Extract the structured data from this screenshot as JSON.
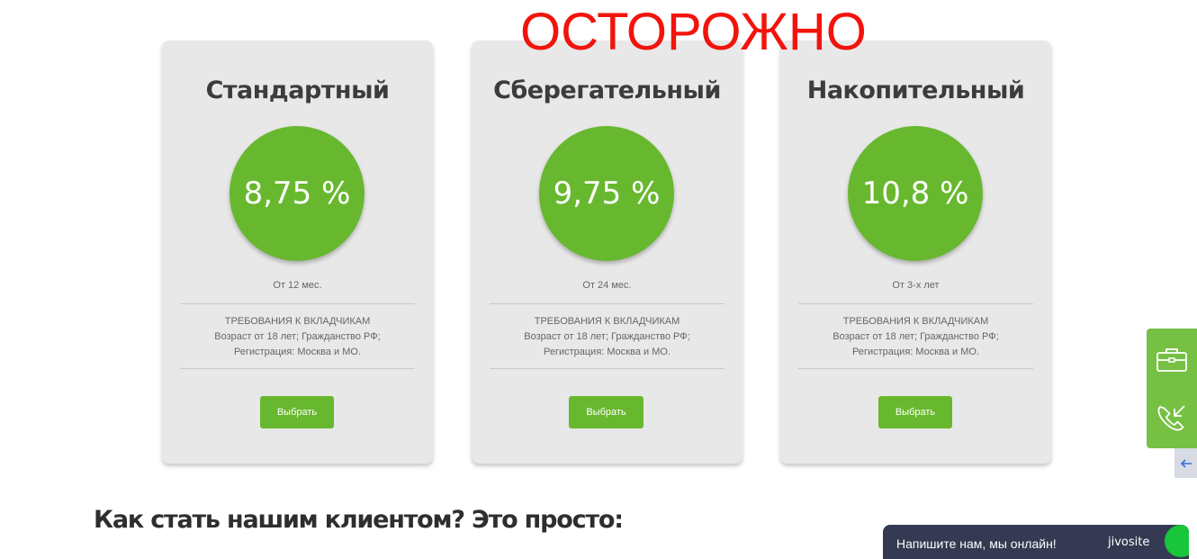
{
  "warning": "ОСТОРОЖНО",
  "colors": {
    "accent_green": "#68b82f",
    "warning_red": "#f2140c",
    "card_bg": "#e8e8e8",
    "chat_bg": "#353a52"
  },
  "plans": [
    {
      "title": "Стандартный",
      "rate": "8,75 %",
      "term": "От 12 мес.",
      "requirements_title": "ТРЕБОВАНИЯ К ВКЛАДЧИКАМ",
      "requirements_line1": "Возраст от 18 лет; Гражданство РФ;",
      "requirements_line2": "Регистрация: Москва и МО.",
      "button": "Выбрать"
    },
    {
      "title": "Сберегательный",
      "rate": "9,75 %",
      "term": "От 24 мес.",
      "requirements_title": "ТРЕБОВАНИЯ К ВКЛАДЧИКАМ",
      "requirements_line1": "Возраст от 18 лет; Гражданство РФ;",
      "requirements_line2": "Регистрация: Москва и МО.",
      "button": "Выбрать"
    },
    {
      "title": "Накопительный",
      "rate": "10,8 %",
      "term": "От 3-х лет",
      "requirements_title": "ТРЕБОВАНИЯ К ВКЛАДЧИКАМ",
      "requirements_line1": "Возраст от 18 лет; Гражданство РФ;",
      "requirements_line2": "Регистрация: Москва и МО.",
      "button": "Выбрать"
    }
  ],
  "section_heading": "Как стать нашим клиентом? Это просто:",
  "side_panel": {
    "icons": [
      "briefcase-icon",
      "phone-callback-icon",
      "arrow-left-icon"
    ]
  },
  "chat": {
    "label": "Напишите нам, мы онлайн!",
    "brand": "jivosite"
  }
}
